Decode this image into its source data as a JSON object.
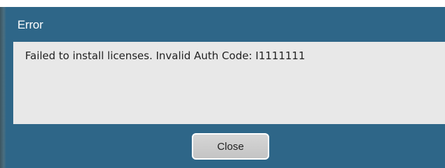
{
  "dialog": {
    "title": "Error",
    "message": "Failed to install licenses. Invalid Auth Code: I1111111",
    "close_label": "Close"
  },
  "colors": {
    "header": "#2e6688",
    "panel": "#e8e8e8",
    "button": "#cccccc"
  }
}
